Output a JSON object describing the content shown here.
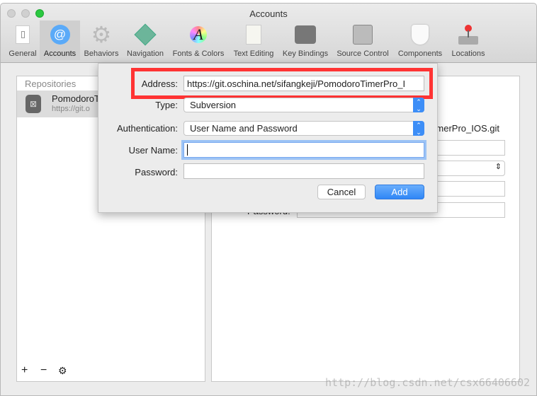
{
  "window": {
    "title": "Accounts"
  },
  "toolbar": [
    {
      "label": "General",
      "icon": "general-switch-icon"
    },
    {
      "label": "Accounts",
      "icon": "at-sign-icon",
      "selected": true
    },
    {
      "label": "Behaviors",
      "icon": "gear-icon"
    },
    {
      "label": "Navigation",
      "icon": "navigation-arrows-icon"
    },
    {
      "label": "Fonts & Colors",
      "icon": "font-color-icon"
    },
    {
      "label": "Text Editing",
      "icon": "text-editing-icon"
    },
    {
      "label": "Key Bindings",
      "icon": "option-key-icon"
    },
    {
      "label": "Source Control",
      "icon": "safe-icon"
    },
    {
      "label": "Components",
      "icon": "shield-icon"
    },
    {
      "label": "Locations",
      "icon": "joystick-icon"
    }
  ],
  "repositories": {
    "header": "Repositories",
    "items": [
      {
        "name": "PomodoroT",
        "url": "https://git.o"
      }
    ],
    "add": "+",
    "remove": "−"
  },
  "detail": {
    "address_tail": "merPro_IOS.git",
    "password_label": "Password:",
    "password_value": "••••••••••••••"
  },
  "sheet": {
    "address_label": "Address:",
    "address_value": "https://git.oschina.net/sifangkeji/PomodoroTimerPro_I",
    "type_label": "Type:",
    "type_value": "Subversion",
    "auth_label": "Authentication:",
    "auth_value": "User Name and Password",
    "user_label": "User Name:",
    "user_value": "",
    "password_label": "Password:",
    "password_value": "",
    "cancel": "Cancel",
    "add": "Add"
  },
  "highlight_color": "#ff3333",
  "accent_color": "#3d8ef7",
  "watermark": "http://blog.csdn.net/csx66406602"
}
